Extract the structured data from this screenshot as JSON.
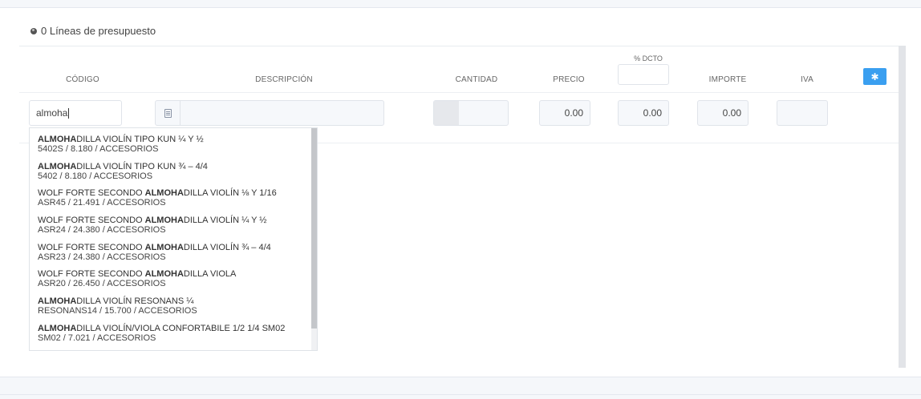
{
  "section": {
    "title": "0 Líneas de presupuesto",
    "icon": "globe-icon"
  },
  "columns": {
    "codigo": "CÓDIGO",
    "descripcion": "DESCRIPCIÓN",
    "cantidad": "CANTIDAD",
    "precio": "PRECIO",
    "dcto": "% DCTO",
    "importe": "IMPORTE",
    "iva": "IVA"
  },
  "row": {
    "codigo_value": "almoha",
    "descripcion_value": "",
    "cantidad_value": "",
    "precio_value": "0.00",
    "dcto_value": "0.00",
    "importe_value": "0.00",
    "iva_value": ""
  },
  "settings_button_icon": "asterisk-icon",
  "accent_color": "#3a9ff0",
  "suggestions": [
    {
      "match": "ALMOHA",
      "pre": "",
      "post": "DILLA VIOLÍN TIPO KUN ¼ Y ½",
      "sub": "5402S / 8.180 / ACCESORIOS"
    },
    {
      "match": "ALMOHA",
      "pre": "",
      "post": "DILLA VIOLÍN TIPO KUN ¾ – 4/4",
      "sub": "5402 / 8.180 / ACCESORIOS"
    },
    {
      "match": "ALMOHA",
      "pre": "WOLF FORTE SECONDO ",
      "post": "DILLA VIOLÍN ⅛ Y 1/16",
      "sub": "ASR45 / 21.491 / ACCESORIOS"
    },
    {
      "match": "ALMOHA",
      "pre": "WOLF FORTE SECONDO ",
      "post": "DILLA VIOLÍN ¼ Y ½",
      "sub": "ASR24 / 24.380 / ACCESORIOS"
    },
    {
      "match": "ALMOHA",
      "pre": "WOLF FORTE SECONDO ",
      "post": "DILLA VIOLÍN ¾ – 4/4",
      "sub": "ASR23 / 24.380 / ACCESORIOS"
    },
    {
      "match": "ALMOHA",
      "pre": "WOLF FORTE SECONDO ",
      "post": "DILLA VIOLA",
      "sub": "ASR20 / 26.450 / ACCESORIOS"
    },
    {
      "match": "ALMOHA",
      "pre": "",
      "post": "DILLA VIOLÍN RESONANS ¼",
      "sub": "RESONANS14 / 15.700 / ACCESORIOS"
    },
    {
      "match": "ALMOHA",
      "pre": "",
      "post": "DILLA VIOLÍN/VIOLA CONFORTABILE 1/2 1/4 SM02",
      "sub": "SM02 / 7.021 / ACCESORIOS"
    }
  ]
}
